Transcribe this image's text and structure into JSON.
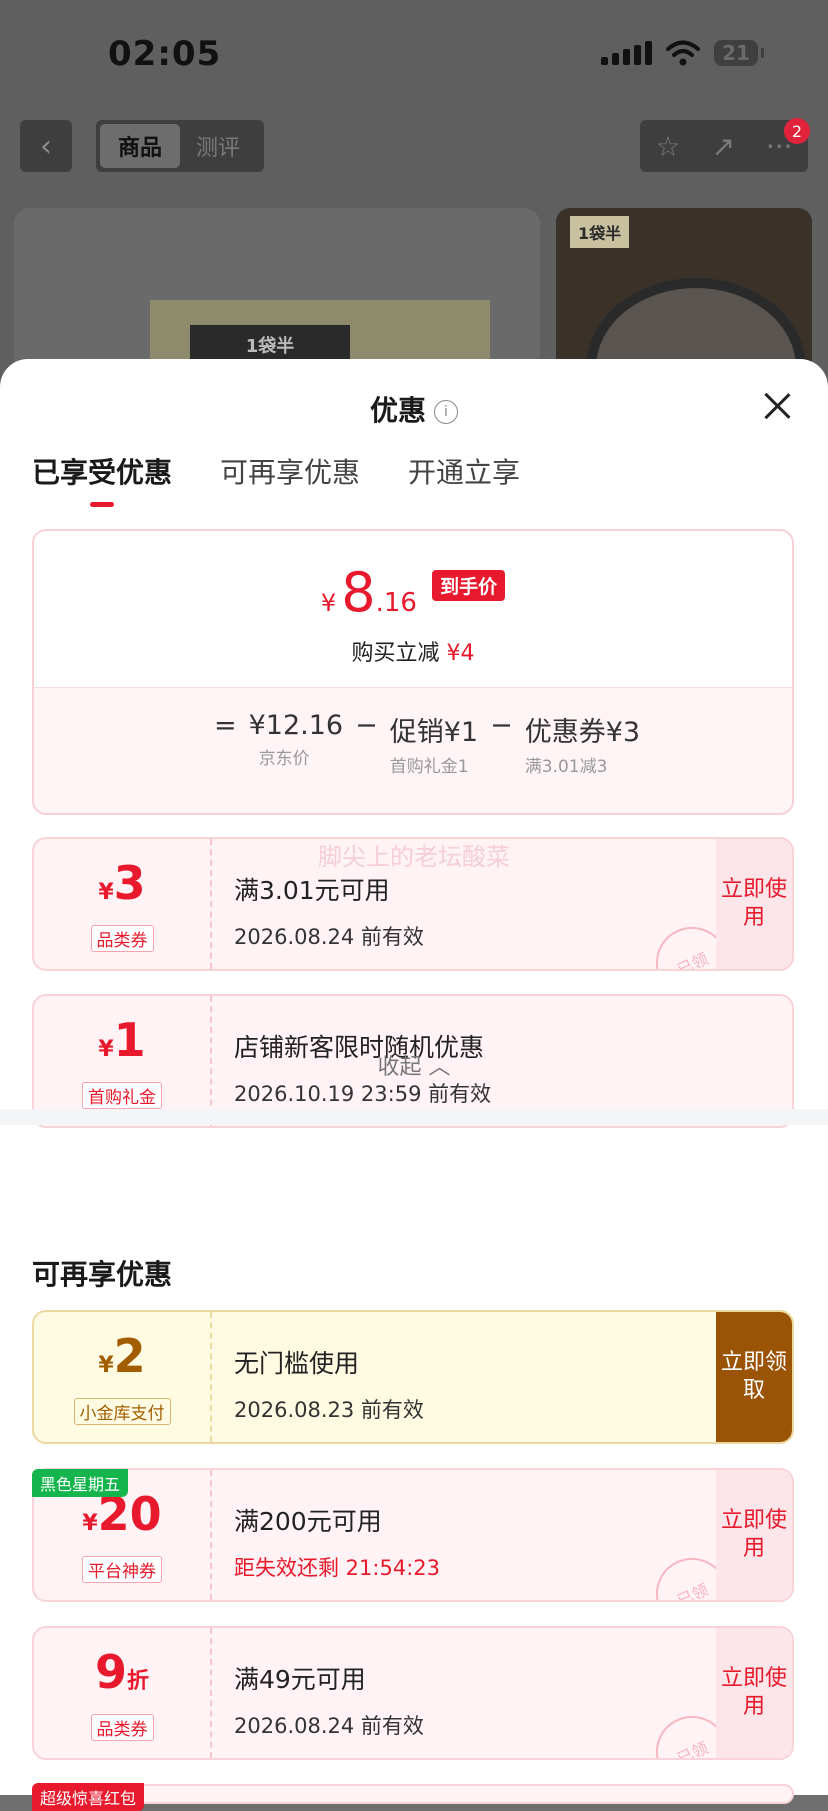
{
  "status_bar": {
    "time": "02:05",
    "battery": "21"
  },
  "nav": {
    "tabs": [
      "商品",
      "测评"
    ],
    "badge": "2"
  },
  "product": {
    "brand_label": "1袋半",
    "thumb_tag": "1袋半"
  },
  "sheet": {
    "title": "优惠",
    "tabs": [
      "已享受优惠",
      "可再享优惠",
      "开通立享"
    ],
    "summary": {
      "currency": "¥",
      "price_int": "8",
      "price_dec": ".16",
      "price_tag": "到手价",
      "reduce_label": "购买立减",
      "reduce_amount": "¥4",
      "eq": "=",
      "minus": "−",
      "items": [
        {
          "main": "¥12.16",
          "sub": "京东价"
        },
        {
          "main": "促销¥1",
          "sub": "首购礼金1"
        },
        {
          "main": "优惠券¥3",
          "sub": "满3.01减3"
        }
      ]
    },
    "ghost_text": "脚尖上的老坛酸菜",
    "enjoyed": [
      {
        "yen": "¥",
        "value": "3",
        "kind": "品类券",
        "cond": "满3.01元可用",
        "exp": "2026.08.24 前有效",
        "action": "立即使用",
        "stamp": "已领"
      },
      {
        "yen": "¥",
        "value": "1",
        "kind": "首购礼金",
        "cond": "店铺新客限时随机优惠",
        "exp": "2026.10.19 23:59 前有效"
      }
    ],
    "collapse_label": "收起 ︿",
    "more_title": "可再享优惠",
    "more": [
      {
        "yen": "¥",
        "value": "2",
        "kind": "小金库支付",
        "cond": "无门槛使用",
        "exp": "2026.08.23 前有效",
        "action": "立即领取"
      },
      {
        "ribbon": "黑色星期五",
        "yen": "¥",
        "value": "20",
        "kind": "平台神券",
        "cond": "满200元可用",
        "exp": "距失效还剩 21:54:23",
        "action": "立即使用",
        "stamp": "已领"
      },
      {
        "value": "9",
        "zhe": "折",
        "kind": "品类券",
        "cond": "满49元可用",
        "exp": "2026.08.24 前有效",
        "action": "立即使用",
        "stamp": "已领"
      },
      {
        "ribbon": "超级惊喜红包"
      }
    ]
  },
  "colors": {
    "accent": "#e8192c",
    "gold": "#9b5305"
  }
}
